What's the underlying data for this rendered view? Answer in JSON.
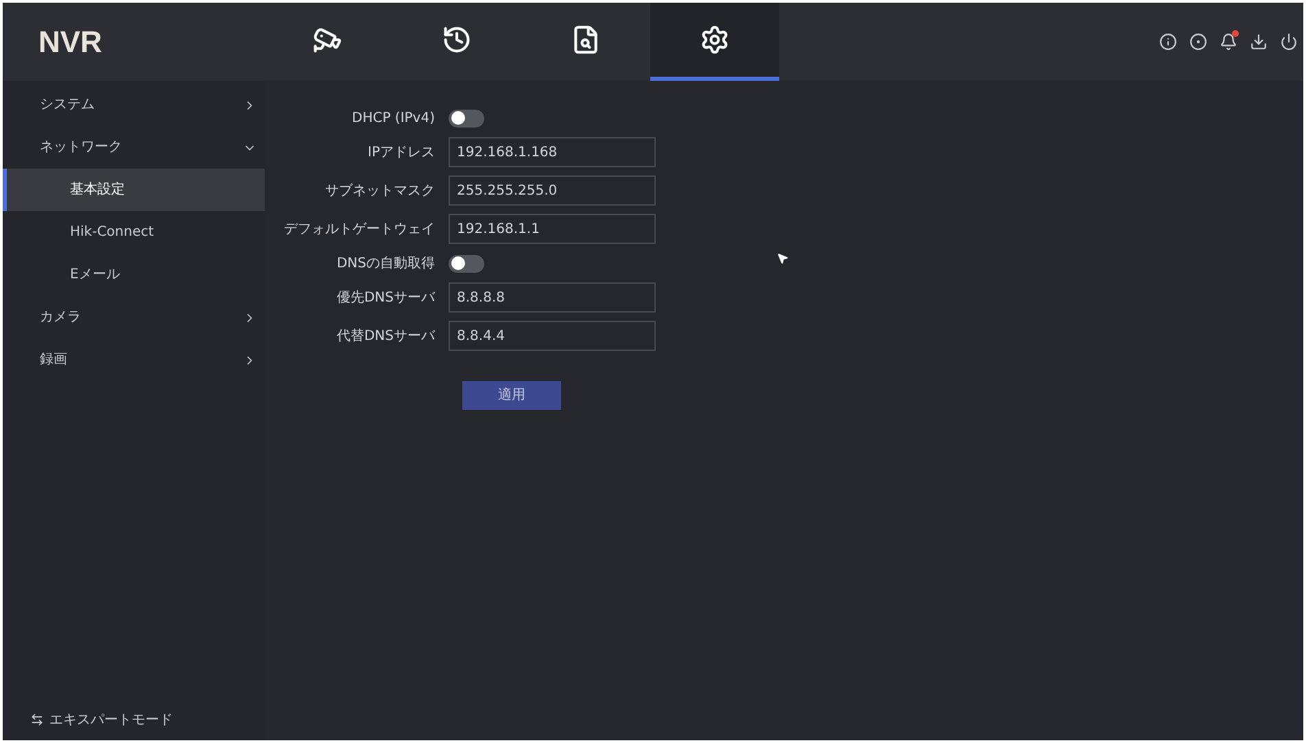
{
  "header": {
    "logo": "NVR",
    "tabs": [
      {
        "kind": "camera",
        "selected": false
      },
      {
        "kind": "playback",
        "selected": false
      },
      {
        "kind": "search",
        "selected": false
      },
      {
        "kind": "settings",
        "selected": true
      }
    ],
    "notification": true
  },
  "sidebar": {
    "items": [
      {
        "label": "システム",
        "expanded": false,
        "selected": false
      },
      {
        "label": "ネットワーク",
        "expanded": true,
        "selected": false,
        "children": [
          {
            "label": "基本設定",
            "selected": true
          },
          {
            "label": "Hik-Connect",
            "selected": false
          },
          {
            "label": "Eメール",
            "selected": false
          }
        ]
      },
      {
        "label": "カメラ",
        "expanded": false,
        "selected": false
      },
      {
        "label": "録画",
        "expanded": false,
        "selected": false
      }
    ],
    "footer": "エキスパートモード"
  },
  "form": {
    "rows": [
      {
        "kind": "toggle",
        "label": "DHCP (IPv4)",
        "on": false
      },
      {
        "kind": "field",
        "label": "IPアドレス",
        "value": "192.168.1.168"
      },
      {
        "kind": "field",
        "label": "サブネットマスク",
        "value": "255.255.255.0"
      },
      {
        "kind": "field",
        "label": "デフォルトゲートウェイ",
        "value": "192.168.1.1"
      },
      {
        "kind": "toggle",
        "label": "DNSの自動取得",
        "on": false
      },
      {
        "kind": "field",
        "label": "優先DNSサーバ",
        "value": "8.8.8.8"
      },
      {
        "kind": "field",
        "label": "代替DNSサーバ",
        "value": "8.8.4.4"
      }
    ],
    "apply": "適用"
  }
}
